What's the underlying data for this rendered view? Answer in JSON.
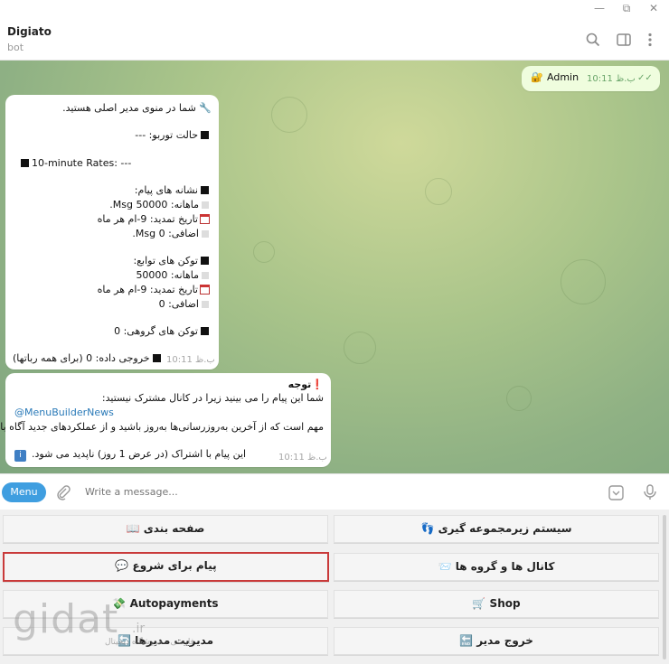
{
  "window": {
    "minimize": "—",
    "restore": "⧉",
    "close": "✕"
  },
  "header": {
    "title": "Digiato",
    "subtitle": "bot"
  },
  "messages": {
    "outgoing": {
      "text": "Admin",
      "time": "ب.ظ 10:11"
    },
    "menu_msg": {
      "lines": [
        "شما در منوی مدیر اصلی هستید.",
        "حالت توربو: ---",
        "10-minute Rates: ---",
        "نشانه های پیام:",
        "ماهانه: 50000 Msg.",
        "تاریخ تمدید: 9-ام هر ماه",
        "اضافی: 0 Msg.",
        "توکن های توابع:",
        "ماهانه: 50000",
        "تاریخ تمدید: 9-ام هر ماه",
        "اضافی: 0",
        "توکن های گروهی: 0",
        "خروجی داده: 0 (برای همه رباتها)"
      ],
      "time": "ب.ظ 10:11"
    },
    "notice_msg": {
      "title": "توجه",
      "line1": "شما این پیام را می بینید زیرا در کانال مشترک نیستید:",
      "link": "@MenuBuilderNews",
      "line2": "مهم است که از آخرین به‌روزرسانی‌ها به‌روز باشید و از عملکردهای جدید آگاه باشید.",
      "line3": ".این پیام با اشتراک (در عرض 1 روز) ناپدید می شود",
      "time": "ب.ظ 10:11"
    }
  },
  "composer": {
    "menu_label": "Menu",
    "placeholder": "Write a message..."
  },
  "keyboard": {
    "btn_subscription": "سیستم زیرمجموعه گیری",
    "btn_pagination": "صفحه بندی",
    "btn_channels": "کانال ها و گروه ها",
    "btn_start_message": "پیام برای شروع",
    "btn_shop": "Shop",
    "btn_autopayments": "Autopayments",
    "btn_exit_admin": "خروج مدیر",
    "btn_admin_management": "مدیریت مدیرها"
  },
  "watermark": {
    "logo": "gidat",
    "tld": ".ir",
    "tagline": "فارسی - فروشگاه دیجیتال"
  },
  "colors": {
    "accent": "#3f9ee0",
    "highlight_border": "#c93a3a"
  }
}
